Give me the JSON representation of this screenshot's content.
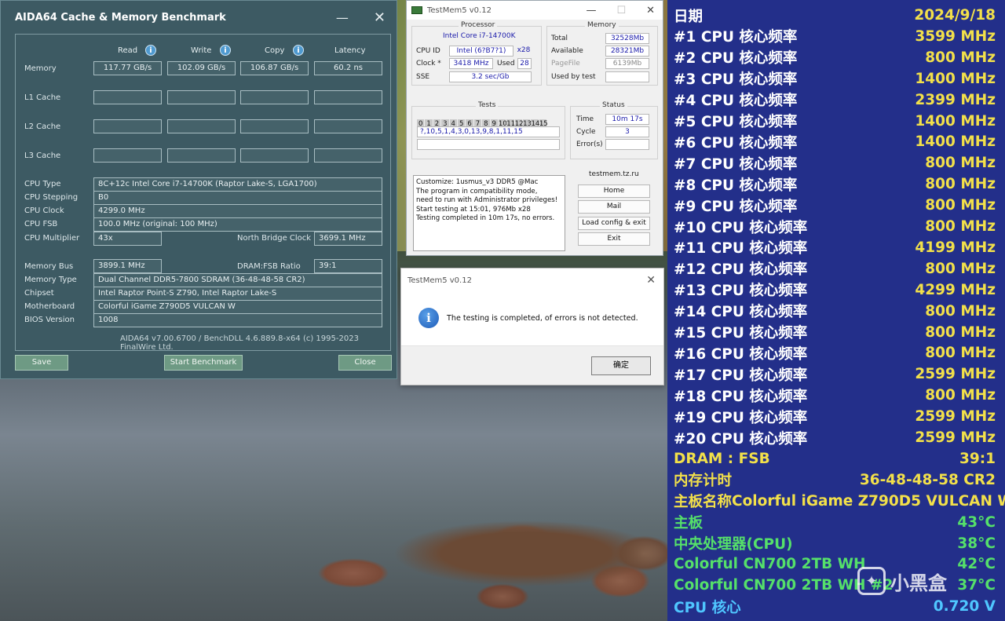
{
  "aida": {
    "title": "AIDA64 Cache & Memory Benchmark",
    "headers": [
      "Read",
      "Write",
      "Copy",
      "Latency"
    ],
    "rows": [
      {
        "label": "Memory",
        "values": [
          "117.77 GB/s",
          "102.09 GB/s",
          "106.87 GB/s",
          "60.2 ns"
        ]
      },
      {
        "label": "L1 Cache",
        "values": [
          "",
          "",
          "",
          ""
        ]
      },
      {
        "label": "L2 Cache",
        "values": [
          "",
          "",
          "",
          ""
        ]
      },
      {
        "label": "L3 Cache",
        "values": [
          "",
          "",
          "",
          ""
        ]
      }
    ],
    "cpu_type_label": "CPU Type",
    "cpu_type": "8C+12c Intel Core i7-14700K  (Raptor Lake-S, LGA1700)",
    "cpu_stepping_label": "CPU Stepping",
    "cpu_stepping": "B0",
    "cpu_clock_label": "CPU Clock",
    "cpu_clock": "4299.0 MHz",
    "cpu_fsb_label": "CPU FSB",
    "cpu_fsb": "100.0 MHz  (original: 100 MHz)",
    "cpu_mult_label": "CPU Multiplier",
    "cpu_mult": "43x",
    "nb_clock_label": "North Bridge Clock",
    "nb_clock": "3699.1 MHz",
    "mem_bus_label": "Memory Bus",
    "mem_bus": "3899.1 MHz",
    "dram_fsb_label": "DRAM:FSB Ratio",
    "dram_fsb": "39:1",
    "mem_type_label": "Memory Type",
    "mem_type": "Dual Channel DDR5-7800 SDRAM  (36-48-48-58 CR2)",
    "chipset_label": "Chipset",
    "chipset": "Intel Raptor Point-S Z790, Intel Raptor Lake-S",
    "mobo_label": "Motherboard",
    "mobo": "Colorful iGame Z790D5 VULCAN W",
    "bios_label": "BIOS Version",
    "bios": "1008",
    "footer": "AIDA64 v7.00.6700 / BenchDLL 4.6.889.8-x64  (c) 1995-2023 FinalWire Ltd.",
    "save": "Save",
    "start": "Start Benchmark",
    "close": "Close"
  },
  "tm": {
    "title": "TestMem5 v0.12",
    "processor_label": "Processor",
    "processor": "Intel Core i7-14700K",
    "cpuid_label": "CPU ID",
    "cpuid": "Intel (6?B7?1)",
    "threads": "x28",
    "clock_label": "Clock *",
    "clock": "3418 MHz",
    "used_label": "Used",
    "used": "28",
    "sse_label": "SSE",
    "sse": "3.2 sec/Gb",
    "memory_label": "Memory",
    "total_label": "Total",
    "total": "32528Mb",
    "avail_label": "Available",
    "avail": "28321Mb",
    "pagefile_label": "PageFile",
    "pagefile": "6139Mb",
    "usedby_label": "Used by test",
    "usedby": "",
    "tests_label": "Tests",
    "tests": [
      "0",
      "1",
      "2",
      "3",
      "4",
      "5",
      "6",
      "7",
      "8",
      "9",
      "10",
      "11",
      "12",
      "13",
      "14",
      "15"
    ],
    "sequence": "?,10,5,1,4,3,0,13,9,8,1,11,15",
    "status_label": "Status",
    "time_label": "Time",
    "time": "10m 17s",
    "cycle_label": "Cycle",
    "cycle": "3",
    "errors_label": "Error(s)",
    "errors": "",
    "log": [
      "Customize: 1usmus_v3 DDR5 @Mac",
      "The program in compatibility mode,",
      "need to run with Administrator privileges!",
      "Start testing at 15:01, 976Mb x28",
      "Testing completed in 10m 17s, no errors."
    ],
    "site": "testmem.tz.ru",
    "home": "Home",
    "mail": "Mail",
    "load": "Load config & exit",
    "exit": "Exit"
  },
  "dialog": {
    "title": "TestMem5 v0.12",
    "message": "The testing is completed, of errors is not detected.",
    "ok": "确定"
  },
  "osd": [
    {
      "k": "日期",
      "v": "2024/9/18",
      "c": "#ffffff",
      "vc": "#f2e04a"
    },
    {
      "k": "#1 CPU 核心频率",
      "v": "3599 MHz",
      "c": "#ffffff",
      "vc": "#f2e04a"
    },
    {
      "k": "#2 CPU 核心频率",
      "v": "800 MHz",
      "c": "#ffffff",
      "vc": "#f2e04a"
    },
    {
      "k": "#3 CPU 核心频率",
      "v": "1400 MHz",
      "c": "#ffffff",
      "vc": "#f2e04a"
    },
    {
      "k": "#4 CPU 核心频率",
      "v": "2399 MHz",
      "c": "#ffffff",
      "vc": "#f2e04a"
    },
    {
      "k": "#5 CPU 核心频率",
      "v": "1400 MHz",
      "c": "#ffffff",
      "vc": "#f2e04a"
    },
    {
      "k": "#6 CPU 核心频率",
      "v": "1400 MHz",
      "c": "#ffffff",
      "vc": "#f2e04a"
    },
    {
      "k": "#7 CPU 核心频率",
      "v": "800 MHz",
      "c": "#ffffff",
      "vc": "#f2e04a"
    },
    {
      "k": "#8 CPU 核心频率",
      "v": "800 MHz",
      "c": "#ffffff",
      "vc": "#f2e04a"
    },
    {
      "k": "#9 CPU 核心频率",
      "v": "800 MHz",
      "c": "#ffffff",
      "vc": "#f2e04a"
    },
    {
      "k": "#10 CPU 核心频率",
      "v": "800 MHz",
      "c": "#ffffff",
      "vc": "#f2e04a"
    },
    {
      "k": "#11 CPU 核心频率",
      "v": "4199 MHz",
      "c": "#ffffff",
      "vc": "#f2e04a"
    },
    {
      "k": "#12 CPU 核心频率",
      "v": "800 MHz",
      "c": "#ffffff",
      "vc": "#f2e04a"
    },
    {
      "k": "#13 CPU 核心频率",
      "v": "4299 MHz",
      "c": "#ffffff",
      "vc": "#f2e04a"
    },
    {
      "k": "#14 CPU 核心频率",
      "v": "800 MHz",
      "c": "#ffffff",
      "vc": "#f2e04a"
    },
    {
      "k": "#15 CPU 核心频率",
      "v": "800 MHz",
      "c": "#ffffff",
      "vc": "#f2e04a"
    },
    {
      "k": "#16 CPU 核心频率",
      "v": "800 MHz",
      "c": "#ffffff",
      "vc": "#f2e04a"
    },
    {
      "k": "#17 CPU 核心频率",
      "v": "2599 MHz",
      "c": "#ffffff",
      "vc": "#f2e04a"
    },
    {
      "k": "#18 CPU 核心频率",
      "v": "800 MHz",
      "c": "#ffffff",
      "vc": "#f2e04a"
    },
    {
      "k": "#19 CPU 核心频率",
      "v": "2599 MHz",
      "c": "#ffffff",
      "vc": "#f2e04a"
    },
    {
      "k": "#20 CPU 核心频率",
      "v": "2599 MHz",
      "c": "#ffffff",
      "vc": "#f2e04a"
    },
    {
      "k": "DRAM : FSB",
      "v": "39:1",
      "c": "#f2e04a",
      "vc": "#f2e04a"
    },
    {
      "k": "内存计时",
      "v": "36-48-48-58 CR2",
      "c": "#f2e04a",
      "vc": "#f2e04a"
    },
    {
      "k": "主板名称",
      "v": "Colorful iGame Z790D5 VULCAN W",
      "c": "#f2e04a",
      "vc": "#f2e04a"
    },
    {
      "k": "主板",
      "v": "43°C",
      "c": "#55e06a",
      "vc": "#55e06a"
    },
    {
      "k": "中央处理器(CPU)",
      "v": "38°C",
      "c": "#55e06a",
      "vc": "#55e06a"
    },
    {
      "k": "Colorful CN700 2TB WH",
      "v": "42°C",
      "c": "#55e06a",
      "vc": "#55e06a"
    },
    {
      "k": "Colorful CN700 2TB WH #2",
      "v": "37°C",
      "c": "#55e06a",
      "vc": "#55e06a"
    },
    {
      "k": "CPU 核心",
      "v": "0.720 V",
      "c": "#4fc6ff",
      "vc": "#4fc6ff"
    }
  ],
  "watermark": "小黑盒",
  "icons": {
    "info": "info-icon",
    "close": "close-icon",
    "dialog_info": "information-icon"
  }
}
